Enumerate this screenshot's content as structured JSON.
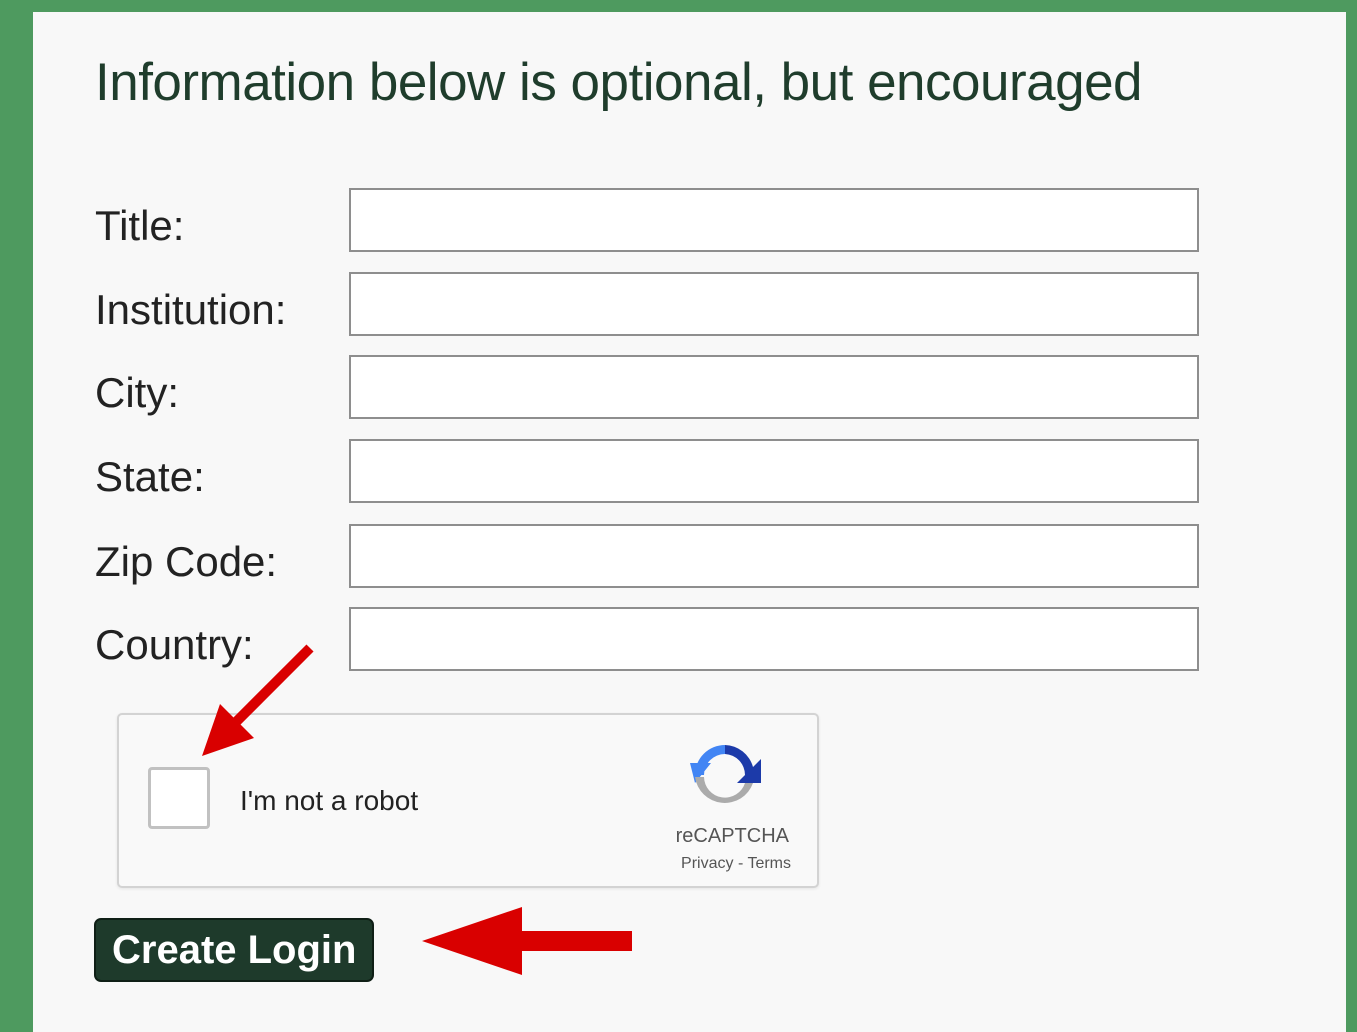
{
  "form": {
    "heading": "Information below is optional, but encouraged",
    "fields": [
      {
        "label": "Title:",
        "value": "",
        "placeholder": ""
      },
      {
        "label": "Institution:",
        "value": "",
        "placeholder": ""
      },
      {
        "label": "City:",
        "value": "",
        "placeholder": ""
      },
      {
        "label": "State:",
        "value": "",
        "placeholder": ""
      },
      {
        "label": "Zip Code:",
        "value": "",
        "placeholder": ""
      },
      {
        "label": "Country:",
        "value": "",
        "placeholder": ""
      }
    ]
  },
  "captcha": {
    "label": "I'm not a robot",
    "checked": false,
    "brand": "reCAPTCHA",
    "privacy": "Privacy",
    "separator": " - ",
    "terms": "Terms",
    "icon": "recaptcha-logo-icon"
  },
  "actions": {
    "create_login_label": "Create Login"
  },
  "annotations": {
    "arrow_color": "#d90000",
    "arrows": [
      "red-arrow-to-checkbox",
      "red-arrow-to-create-login"
    ]
  },
  "colors": {
    "page_background": "#4e9a5f",
    "panel_background": "#f8f8f8",
    "heading_text": "#1f3d2c",
    "button_background": "#1e3a2b"
  }
}
